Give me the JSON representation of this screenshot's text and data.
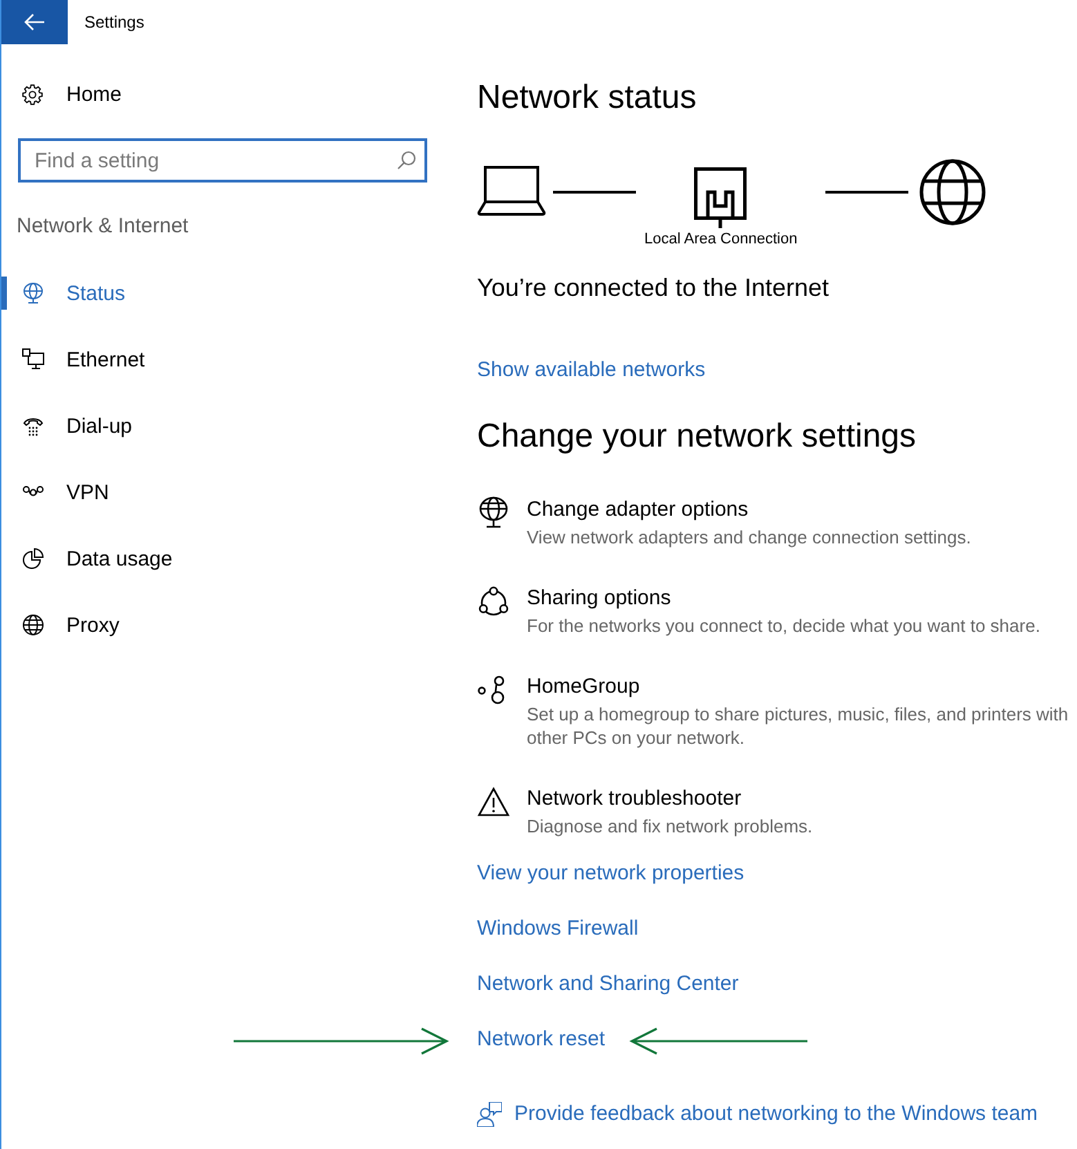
{
  "window": {
    "title": "Settings"
  },
  "sidebar": {
    "home": {
      "label": "Home"
    },
    "search": {
      "placeholder": "Find a setting"
    },
    "section_title": "Network & Internet",
    "items": [
      {
        "kind": "status",
        "label": "Status",
        "selected": true
      },
      {
        "kind": "ethernet",
        "label": "Ethernet",
        "selected": false
      },
      {
        "kind": "dialup",
        "label": "Dial-up",
        "selected": false
      },
      {
        "kind": "vpn",
        "label": "VPN",
        "selected": false
      },
      {
        "kind": "data_usage",
        "label": "Data usage",
        "selected": false
      },
      {
        "kind": "proxy",
        "label": "Proxy",
        "selected": false
      }
    ]
  },
  "main": {
    "status_heading": "Network status",
    "diagram": {
      "nodes": [
        {
          "kind": "computer"
        },
        {
          "kind": "adapter",
          "label": "Local Area Connection"
        },
        {
          "kind": "internet"
        }
      ]
    },
    "connection_status": "You’re connected to the Internet",
    "show_networks_link": "Show available networks",
    "settings_heading": "Change your network settings",
    "settings": [
      {
        "kind": "adapter",
        "title": "Change adapter options",
        "description": "View network adapters and change connection settings."
      },
      {
        "kind": "sharing",
        "title": "Sharing options",
        "description": "For the networks you connect to, decide what you want to share."
      },
      {
        "kind": "homegroup",
        "title": "HomeGroup",
        "description": "Set up a homegroup to share pictures, music, files, and printers with other PCs on your network."
      },
      {
        "kind": "troubleshooter",
        "title": "Network troubleshooter",
        "description": "Diagnose and fix network problems."
      }
    ],
    "links": [
      {
        "label": "View your network properties",
        "annotated": false
      },
      {
        "label": "Windows Firewall",
        "annotated": false
      },
      {
        "label": "Network and Sharing Center",
        "annotated": false
      },
      {
        "label": "Network reset",
        "annotated": true
      }
    ],
    "feedback_link": "Provide feedback about networking to the Windows team"
  }
}
